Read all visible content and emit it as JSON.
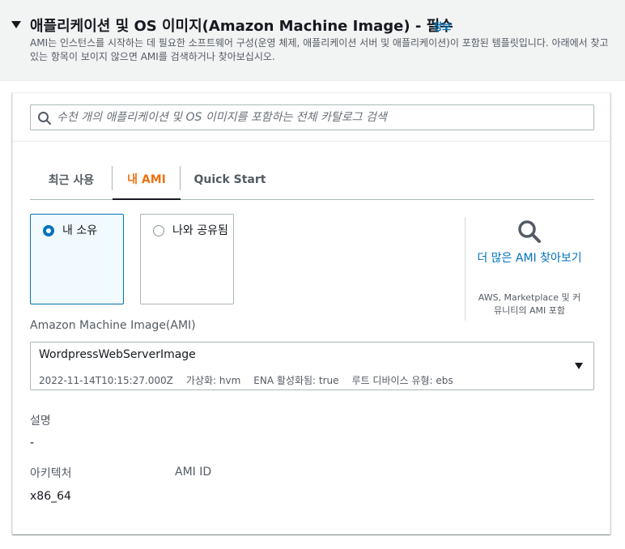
{
  "section": {
    "title": "애플리케이션 및 OS 이미지(Amazon Machine Image) - 필수",
    "info_link": "정보",
    "description": "AMI는 인스턴스를 시작하는 데 필요한 소프트웨어 구성(운영 체제, 애플리케이션 서버 및 애플리케이션)이 포함된 템플릿입니다. 아래에서 찾고 있는 항목이 보이지 않으면 AMI를 검색하거나 찾아보십시오."
  },
  "search": {
    "placeholder": "수천 개의 애플리케이션 및 OS 이미지를 포함하는 전체 카탈로그 검색",
    "value": ""
  },
  "tabs": [
    {
      "label": "최근 사용",
      "active": false
    },
    {
      "label": "내 AMI",
      "active": true
    },
    {
      "label": "Quick Start",
      "active": false
    }
  ],
  "ownership": {
    "options": [
      {
        "label": "내 소유",
        "selected": true
      },
      {
        "label": "나와 공유됨",
        "selected": false
      }
    ]
  },
  "browse": {
    "link": "더 많은 AMI 찾아보기",
    "subtext": "AWS, Marketplace 및 커뮤니티의 AMI 포함"
  },
  "ami": {
    "label": "Amazon Machine Image(AMI)",
    "selected_name": "WordpressWebServerImage",
    "created": "2022-11-14T10:15:27.000Z",
    "virtualization": "가상화: hvm",
    "ena": "ENA 활성화됨: true",
    "root_device": "루트 디바이스 유형: ebs"
  },
  "details": {
    "description_label": "설명",
    "description_value": "-",
    "architecture_label": "아키텍처",
    "architecture_value": "x86_64",
    "ami_id_label": "AMI ID",
    "ami_id_value": ""
  },
  "colors": {
    "accent_blue": "#0073bb",
    "active_tab_orange": "#ec7211",
    "header_background": "#f2f3f3"
  }
}
